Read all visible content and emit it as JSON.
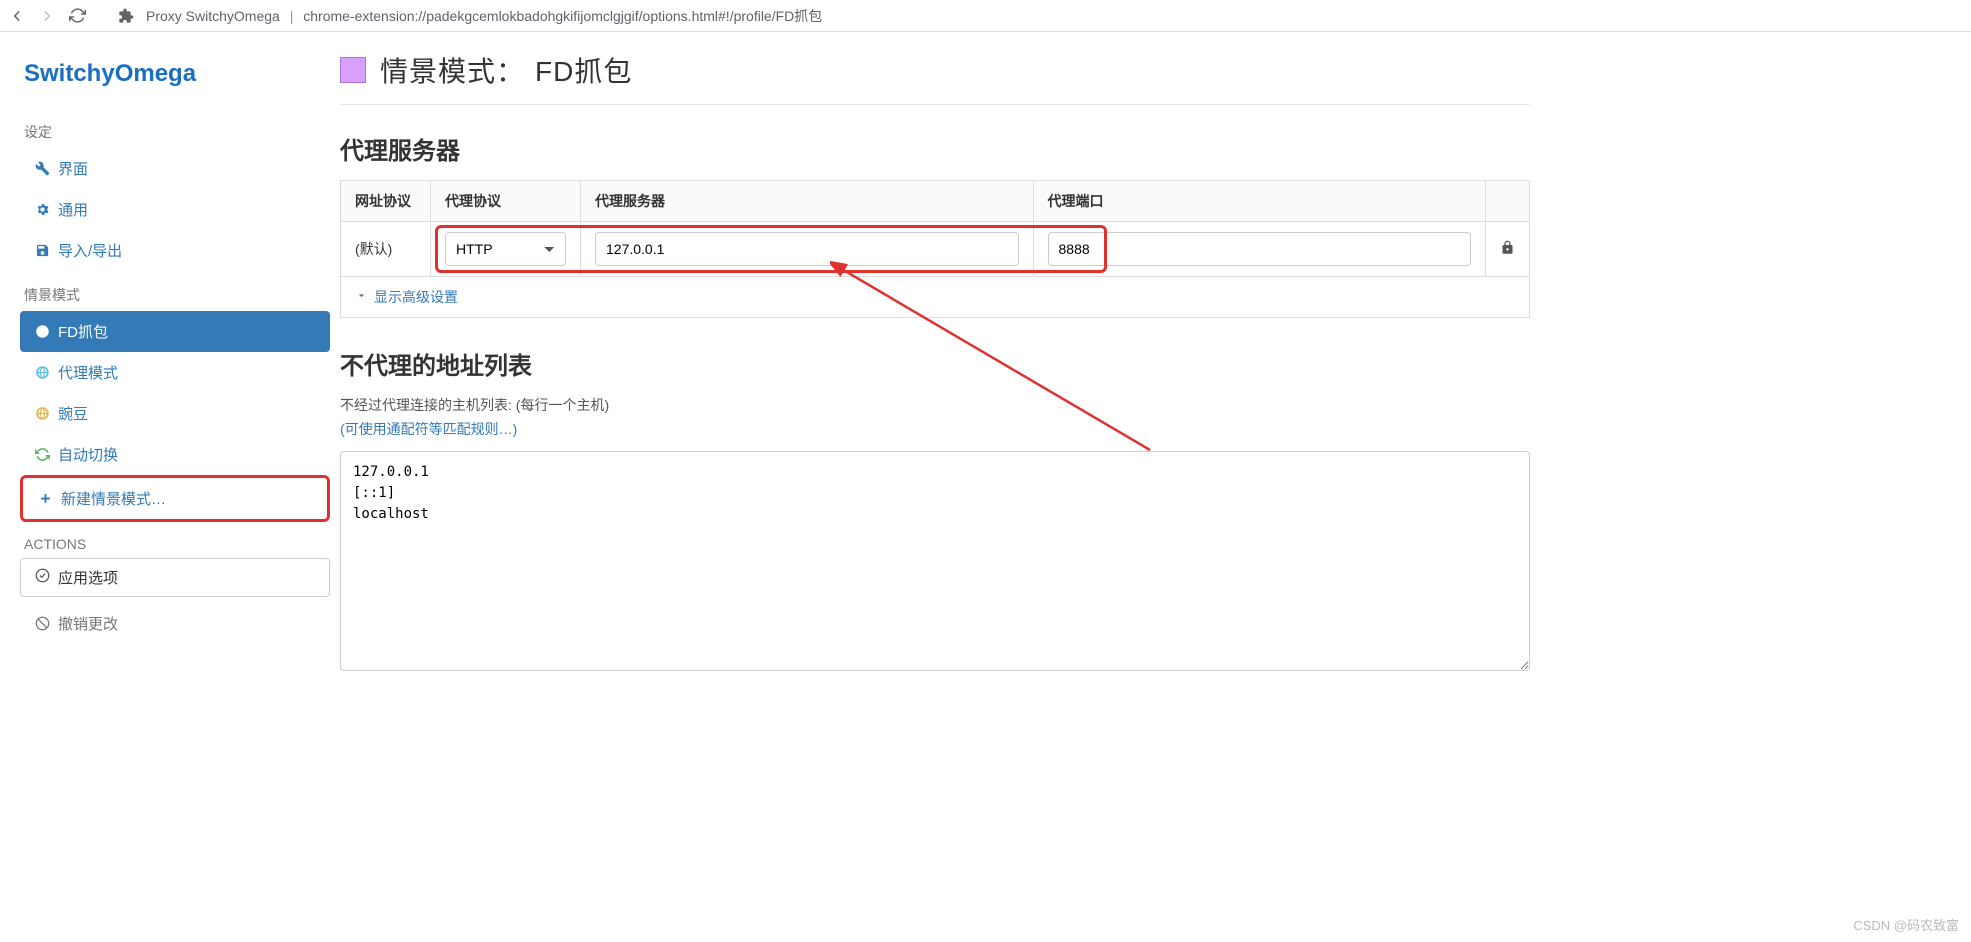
{
  "browser": {
    "title": "Proxy SwitchyOmega",
    "url": "chrome-extension://padekgcemlokbadohgkifijomclgjgif/options.html#!/profile/FD抓包"
  },
  "brand": "SwitchyOmega",
  "sidebar": {
    "settings_label": "设定",
    "settings": [
      {
        "icon": "wrench-icon",
        "label": "界面"
      },
      {
        "icon": "gear-icon",
        "label": "通用"
      },
      {
        "icon": "save-icon",
        "label": "导入/导出"
      }
    ],
    "profiles_label": "情景模式",
    "profiles": [
      {
        "icon": "globe-icon",
        "label": "FD抓包",
        "active": true
      },
      {
        "icon": "globe-icon",
        "label": "代理模式"
      },
      {
        "icon": "globe-icon",
        "label": "豌豆",
        "color": "#e8b34a"
      },
      {
        "icon": "refresh-icon",
        "label": "自动切换",
        "color": "#5cb85c"
      }
    ],
    "new_profile": "新建情景模式…",
    "actions_label": "ACTIONS",
    "apply": "应用选项",
    "discard": "撤销更改"
  },
  "header": {
    "title_prefix": "情景模式：",
    "profile_name": "FD抓包"
  },
  "proxy_section": {
    "title": "代理服务器",
    "columns": {
      "scheme": "网址协议",
      "protocol": "代理协议",
      "server": "代理服务器",
      "port": "代理端口"
    },
    "row": {
      "scheme": "(默认)",
      "protocol": "HTTP",
      "server": "127.0.0.1",
      "port": "8888"
    },
    "show_advanced": "显示高级设置"
  },
  "bypass_section": {
    "title": "不代理的地址列表",
    "hint": "不经过代理连接的主机列表: (每行一个主机)",
    "hint_link": "(可使用通配符等匹配规则…)",
    "value": "127.0.0.1\n[::1]\nlocalhost"
  },
  "watermark": "CSDN @码农致富"
}
